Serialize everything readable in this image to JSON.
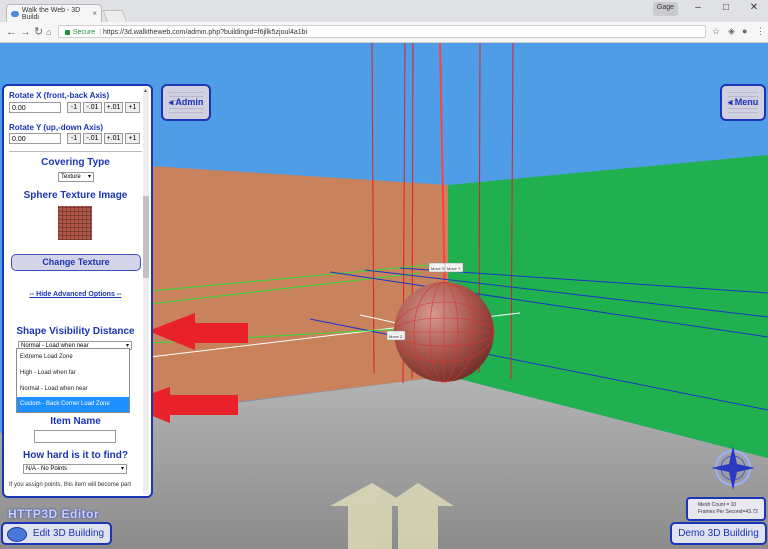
{
  "browser": {
    "tab_title": "Walk the Web - 3D Buildi",
    "tab_close": "×",
    "window_label": "Gage",
    "window_min": "–",
    "window_max": "□",
    "window_close": "✕",
    "secure_label": "Secure",
    "url": "https://3d.walktheweb.com/admin.php?buildingid=f6jllk5zjoul4a1bi"
  },
  "panel": {
    "rotate_x_label": "Rotate X (front,-back Axis)",
    "rotate_x_value": "0.00",
    "rotate_y_label": "Rotate Y (up,-down Axis)",
    "rotate_y_value": "0.00",
    "step_buttons": [
      "-1",
      "-.01",
      "+.01",
      "+1"
    ],
    "covering_type_heading": "Covering Type",
    "covering_type_value": "Texture",
    "sphere_texture_heading": "Sphere Texture Image",
    "change_texture_label": "Change Texture",
    "hide_advanced_label": "-- Hide Advanced Options --",
    "visibility_heading": "Shape Visibility Distance",
    "visibility_selected": "Normal - Load when near",
    "item_name_heading": "Item Name",
    "how_hard_heading": "How hard is it to find?",
    "points_value": "N/A - No Points",
    "note": "If you assign points, this item will become part"
  },
  "visibility_options": [
    "Extreme Load Zone",
    "High - Load when far",
    "Normal - Load when near",
    "Custom - Back Corner Load Zone"
  ],
  "scene": {
    "move_labels": [
      "Move X",
      "Move Y",
      "Move Z"
    ]
  },
  "buttons": {
    "admin": "Admin",
    "menu": "Menu",
    "edit_building": "Edit 3D Building",
    "demo_building": "Demo 3D Building"
  },
  "status": {
    "mesh_count": "Mesh Count = 10",
    "fps": "Frames Per Second=43.72"
  },
  "brand": "HTTP3D Editor",
  "colors": {
    "panel_border": "#1a35b5",
    "arrow_red": "#e8212b",
    "wall_left": "#c8825c",
    "wall_right": "#21b04f",
    "sky": "#4f9de6"
  }
}
